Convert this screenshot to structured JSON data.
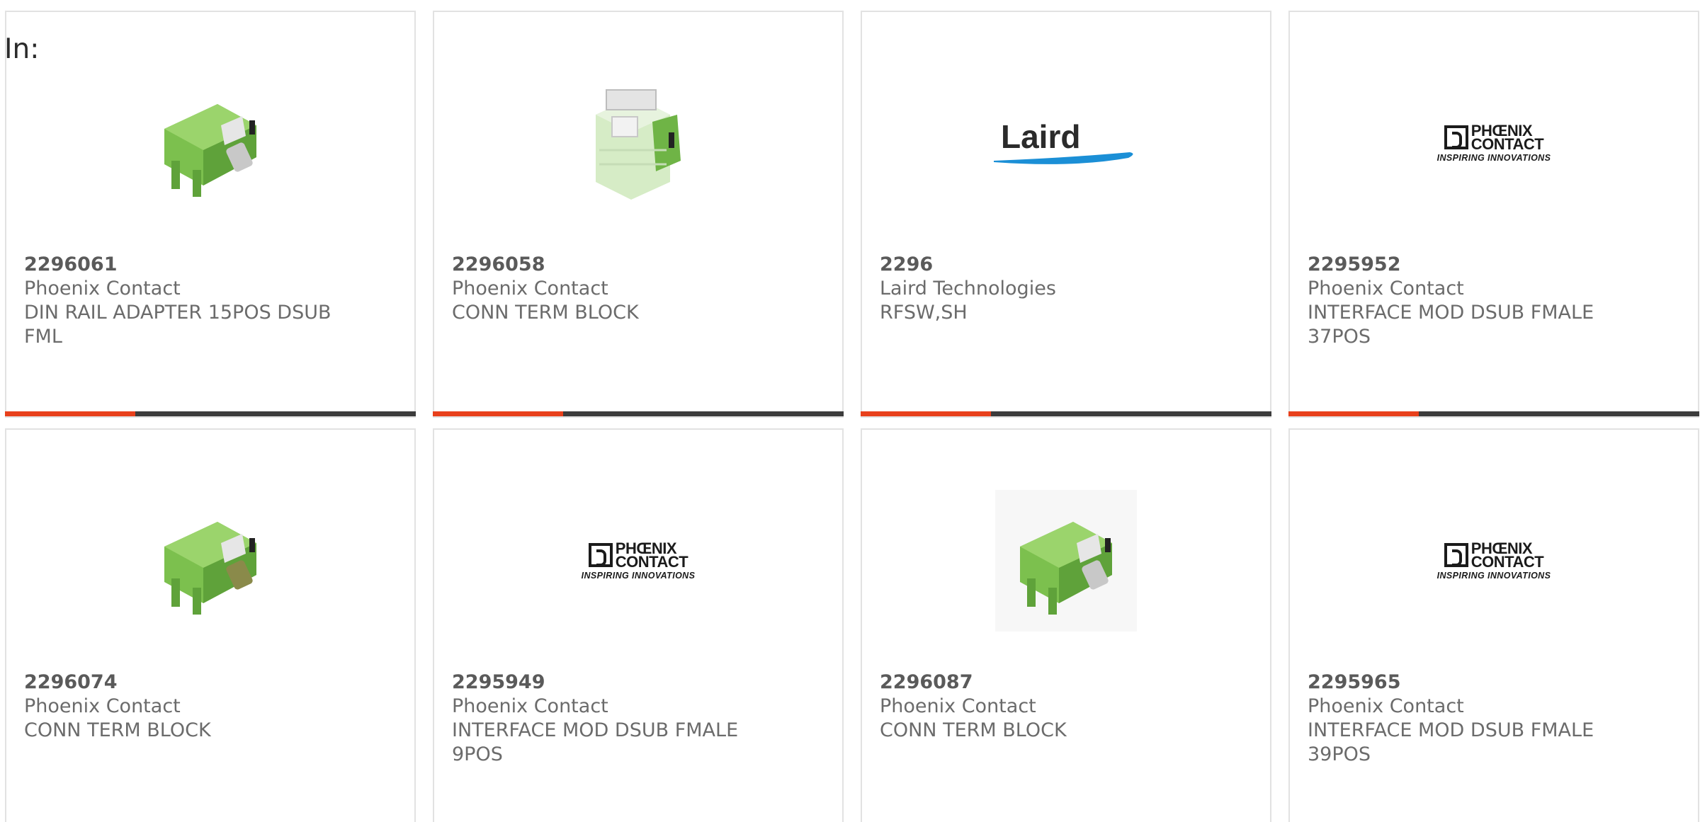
{
  "page": {
    "in_label": "In:"
  },
  "colors": {
    "accent": "#e8401c",
    "bar_dark": "#3c3c3c",
    "card_border": "#e2e2e2",
    "text": "#6b6b6b"
  },
  "products": [
    {
      "part_number": "2296061",
      "manufacturer": "Phoenix Contact",
      "description": "DIN RAIL ADAPTER 15POS DSUB FML",
      "image": "green-interface-module-image"
    },
    {
      "part_number": "2296058",
      "manufacturer": "Phoenix Contact",
      "description": "CONN TERM BLOCK",
      "image": "pale-terminal-block-image"
    },
    {
      "part_number": "2296",
      "manufacturer": "Laird Technologies",
      "description": "RFSW,SH",
      "image": "laird-logo",
      "logo_text": "Laird"
    },
    {
      "part_number": "2295952",
      "manufacturer": "Phoenix Contact",
      "description": "INTERFACE MOD DSUB FMALE 37POS",
      "image": "phoenix-contact-logo",
      "logo_text_1": "PHŒNIX",
      "logo_text_2": "CONTACT",
      "logo_tagline": "INSPIRING INNOVATIONS"
    },
    {
      "part_number": "2296074",
      "manufacturer": "Phoenix Contact",
      "description": "CONN TERM BLOCK",
      "image": "green-interface-module-image"
    },
    {
      "part_number": "2295949",
      "manufacturer": "Phoenix Contact",
      "description": "INTERFACE MOD DSUB FMALE 9POS",
      "image": "phoenix-contact-logo",
      "logo_text_1": "PHŒNIX",
      "logo_text_2": "CONTACT",
      "logo_tagline": "INSPIRING INNOVATIONS"
    },
    {
      "part_number": "2296087",
      "manufacturer": "Phoenix Contact",
      "description": "CONN TERM BLOCK",
      "image": "green-interface-module-image"
    },
    {
      "part_number": "2295965",
      "manufacturer": "Phoenix Contact",
      "description": "INTERFACE MOD DSUB FMALE 39POS",
      "image": "phoenix-contact-logo",
      "logo_text_1": "PHŒNIX",
      "logo_text_2": "CONTACT",
      "logo_tagline": "INSPIRING INNOVATIONS"
    }
  ]
}
